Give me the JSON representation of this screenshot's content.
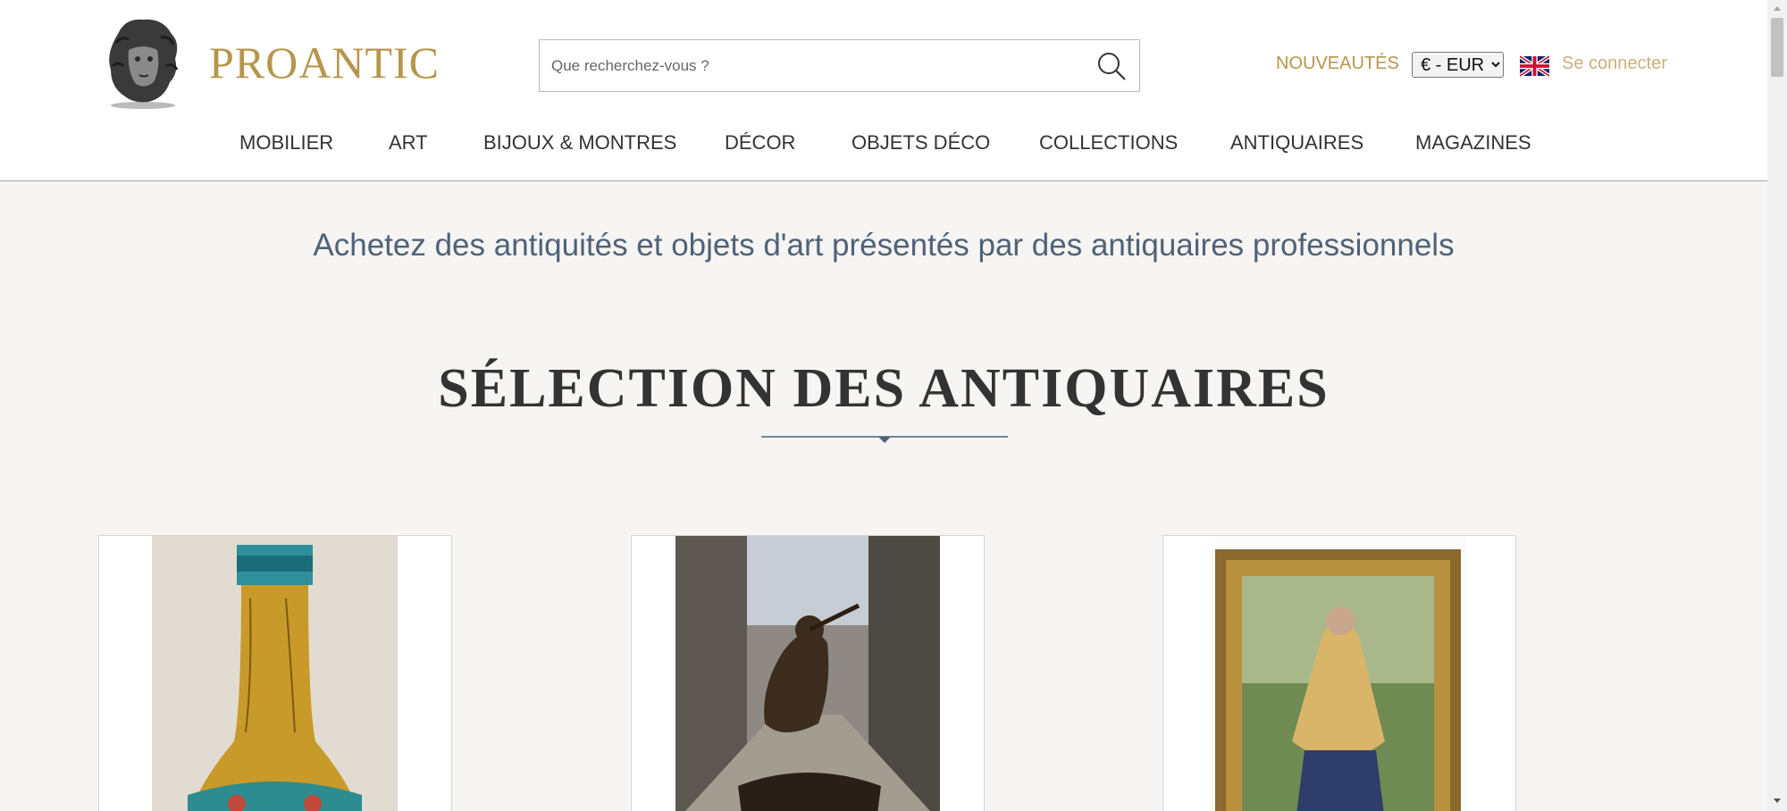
{
  "brand": {
    "name": "PROANTIC"
  },
  "search": {
    "placeholder": "Que recherchez-vous ?"
  },
  "top_links": {
    "new_items": "NOUVEAUTÉS",
    "currency_selected": "€ - EUR",
    "login": "Se connecter"
  },
  "nav": {
    "items": [
      {
        "label": "MOBILIER"
      },
      {
        "label": "ART"
      },
      {
        "label": "BIJOUX & MONTRES"
      },
      {
        "label": "DÉCOR"
      },
      {
        "label": "OBJETS DÉCO"
      },
      {
        "label": "COLLECTIONS"
      },
      {
        "label": "ANTIQUAIRES"
      },
      {
        "label": "MAGAZINES"
      }
    ]
  },
  "main": {
    "tagline": "Achetez des antiquités et objets d'art présentés par des antiquaires professionnels",
    "section_title": "SÉLECTION DES ANTIQUAIRES"
  },
  "colors": {
    "brand_gold": "#b7954b",
    "tagline_blue": "#4f6278",
    "page_bg": "#f6f5f3"
  },
  "icons": {
    "search": "search-icon",
    "flag": "uk-flag-icon",
    "logo": "bust-logo-icon"
  }
}
